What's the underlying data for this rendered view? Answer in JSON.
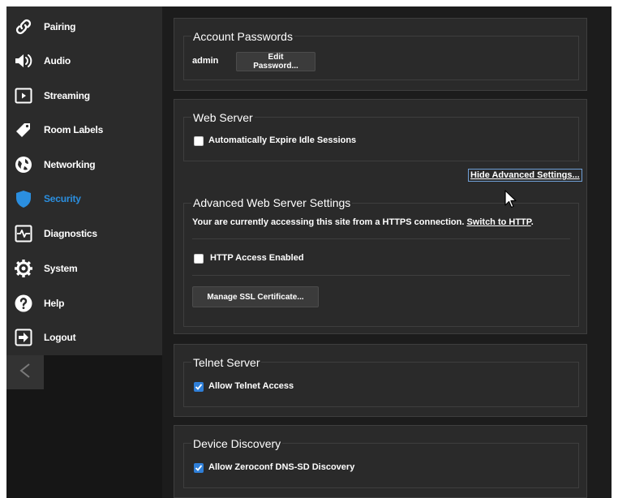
{
  "sidebar": {
    "items": [
      {
        "label": "Pairing",
        "icon": "link-icon"
      },
      {
        "label": "Audio",
        "icon": "speaker-icon"
      },
      {
        "label": "Streaming",
        "icon": "play-icon"
      },
      {
        "label": "Room Labels",
        "icon": "tag-icon"
      },
      {
        "label": "Networking",
        "icon": "globe-icon"
      },
      {
        "label": "Security",
        "icon": "shield-icon",
        "active": true
      },
      {
        "label": "Diagnostics",
        "icon": "pulse-icon"
      },
      {
        "label": "System",
        "icon": "gear-icon"
      },
      {
        "label": "Help",
        "icon": "help-icon"
      },
      {
        "label": "Logout",
        "icon": "logout-icon"
      }
    ],
    "collapse_icon": "chevron-left-icon",
    "active_color": "#2b8fe0"
  },
  "account": {
    "title": "Account Passwords",
    "user": "admin",
    "edit_button": "Edit Password..."
  },
  "web_server": {
    "title": "Web Server",
    "expire_label": "Automatically Expire Idle Sessions",
    "expire_checked": false,
    "hide_advanced": "Hide Advanced Settings...",
    "advanced": {
      "title": "Advanced Web Server Settings",
      "notice_prefix": "Your are currently accessing this site from a HTTPS connection.",
      "switch_link": "Switch to HTTP",
      "notice_suffix": ".",
      "http_label": "HTTP Access Enabled",
      "http_checked": false,
      "ssl_button": "Manage SSL Certificate..."
    }
  },
  "telnet": {
    "title": "Telnet Server",
    "allow_label": "Allow Telnet Access",
    "allow_checked": true
  },
  "discovery": {
    "title": "Device Discovery",
    "allow_label": "Allow Zeroconf DNS-SD Discovery",
    "allow_checked": true
  },
  "colors": {
    "checkbox_on": "#2f7fd8",
    "link_focus": "#6f9fd6"
  }
}
